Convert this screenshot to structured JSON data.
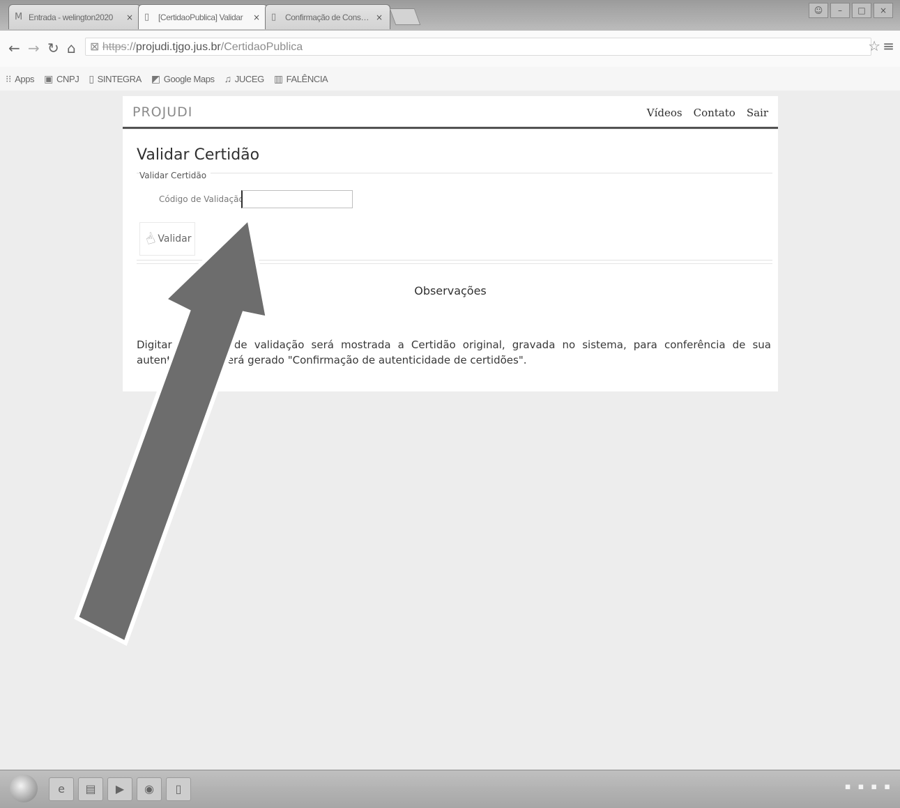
{
  "tabs": [
    {
      "icon": "gmail-icon",
      "label": "Entrada - welington2020",
      "close": "×"
    },
    {
      "icon": "page-icon",
      "label": "[CertidaoPublica] Validar",
      "close": "×"
    },
    {
      "icon": "page-icon",
      "label": "Confirmação de Consulta",
      "close": "×"
    }
  ],
  "address": {
    "scheme": "https",
    "host": "projudi.tjgo.jus.br",
    "path": "CertidaoPublica"
  },
  "bookmarks": [
    {
      "icon": "apps-icon",
      "label": "Apps"
    },
    {
      "icon": "bookmark-icon",
      "label": "CNPJ"
    },
    {
      "icon": "page-icon",
      "label": "SINTEGRA"
    },
    {
      "icon": "maps-icon",
      "label": "Google Maps"
    },
    {
      "icon": "bookmark-icon",
      "label": "JUCEG"
    },
    {
      "icon": "bookmark-icon",
      "label": "FALÊNCIA"
    }
  ],
  "site": {
    "brand": "PROJUDI",
    "nav": [
      "Vídeos",
      "Contato",
      "Sair"
    ]
  },
  "form": {
    "page_title": "Validar Certidão",
    "legend": "Validar Certidão",
    "code_label": "Código de Validação",
    "code_value": "",
    "validate_label": "Validar"
  },
  "observations": {
    "title": "Observações",
    "text": "Digitar o código de validação será mostrada a Certidão original, gravada no sistema, para conferência de sua autenticidade e será gerado \"Confirmação de autenticidade de certidões\"."
  },
  "colors": {
    "arrow_fill": "#6e6e6e",
    "arrow_stroke": "#ffffff"
  }
}
